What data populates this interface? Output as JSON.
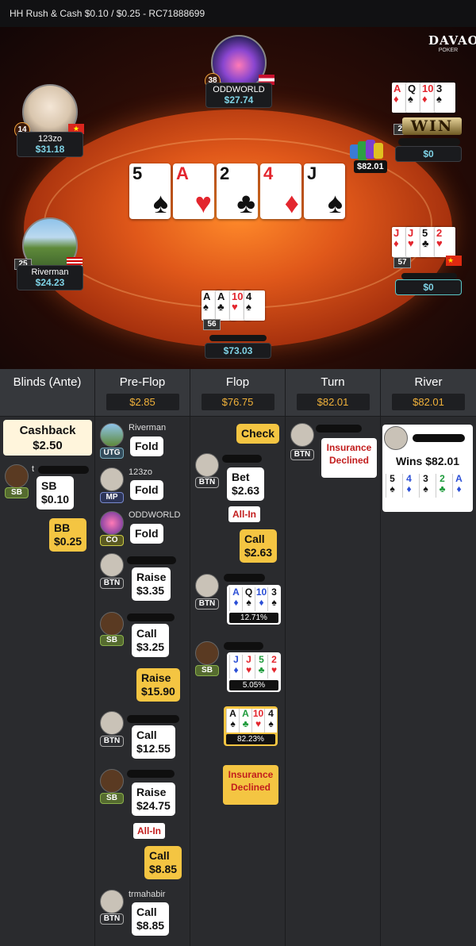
{
  "header": {
    "title": "HH  Rush & Cash $0.10 / $0.25   - RC71888699"
  },
  "logo": {
    "line1": "DAVAO",
    "line2": "POKER"
  },
  "colors": {
    "accent": "#f0b13a",
    "stack": "#7fd3e6",
    "fold_red": "#c21d1d",
    "bubble_yellow": "#f4c542"
  },
  "board": [
    {
      "rank": "5",
      "suit": "♠",
      "color": "blk"
    },
    {
      "rank": "A",
      "suit": "♥",
      "color": "red"
    },
    {
      "rank": "2",
      "suit": "♣",
      "color": "blk"
    },
    {
      "rank": "4",
      "suit": "♦",
      "color": "red"
    },
    {
      "rank": "J",
      "suit": "♠",
      "color": "blk"
    }
  ],
  "seats": {
    "top": {
      "name": "ODDWORLD",
      "stack": "$27.74",
      "level": "38"
    },
    "left_top": {
      "name": "123zo",
      "stack": "$31.18",
      "level": "14"
    },
    "left_bottom": {
      "name": "Riverman",
      "stack": "$24.23",
      "level": "25"
    },
    "bottom": {
      "stack": "$73.03",
      "level": "56"
    },
    "right_top": {
      "stack": "$0",
      "level": "25",
      "win_label": "WIN",
      "pot": "$82.01"
    },
    "right_bottom": {
      "stack": "$0",
      "level": "57"
    }
  },
  "seat_cards": {
    "bottom": [
      {
        "r": "A",
        "s": "♠",
        "c": "blk"
      },
      {
        "r": "A",
        "s": "♣",
        "c": "blk"
      },
      {
        "r": "10",
        "s": "♥",
        "c": "red"
      },
      {
        "r": "4",
        "s": "♠",
        "c": "blk"
      }
    ],
    "right_top": [
      {
        "r": "A",
        "s": "♦",
        "c": "red"
      },
      {
        "r": "Q",
        "s": "♠",
        "c": "blk"
      },
      {
        "r": "10",
        "s": "♦",
        "c": "red"
      },
      {
        "r": "3",
        "s": "♠",
        "c": "blk"
      }
    ],
    "right_bottom": [
      {
        "r": "J",
        "s": "♦",
        "c": "red"
      },
      {
        "r": "J",
        "s": "♥",
        "c": "red"
      },
      {
        "r": "5",
        "s": "♣",
        "c": "blk"
      },
      {
        "r": "2",
        "s": "♥",
        "c": "red"
      }
    ]
  },
  "history": {
    "columns": [
      {
        "title": "Blinds (Ante)",
        "pot": ""
      },
      {
        "title": "Pre-Flop",
        "pot": "$2.85"
      },
      {
        "title": "Flop",
        "pot": "$76.75"
      },
      {
        "title": "Turn",
        "pot": "$82.01"
      },
      {
        "title": "River",
        "pot": "$82.01"
      }
    ],
    "blinds": {
      "cashback_label": "Cashback",
      "cashback_value": "$2.50",
      "sb_name": "t",
      "sb_pos": "SB",
      "sb_action": "SB",
      "sb_amount": "$0.10",
      "bb_action": "BB",
      "bb_amount": "$0.25"
    },
    "preflop": [
      {
        "name": "Riverman",
        "pos": "UTG",
        "action": "Fold"
      },
      {
        "name": "123zo",
        "pos": "MP",
        "action": "Fold"
      },
      {
        "name": "ODDWORLD",
        "pos": "CO",
        "action": "Fold"
      },
      {
        "pos": "BTN",
        "action": "Raise",
        "amount": "$3.35"
      },
      {
        "pos": "SB",
        "action": "Call",
        "amount": "$3.25"
      },
      {
        "action": "Raise",
        "amount": "$15.90"
      },
      {
        "pos": "BTN",
        "action": "Call",
        "amount": "$12.55"
      },
      {
        "pos": "SB",
        "action": "Raise",
        "amount": "$24.75",
        "allin": "All-In"
      },
      {
        "action": "Call",
        "amount": "$8.85"
      },
      {
        "name": "trmahabir",
        "pos": "BTN",
        "action": "Call",
        "amount": "$8.85"
      }
    ],
    "flop": {
      "check": "Check",
      "bet_pos": "BTN",
      "bet_action": "Bet",
      "bet_amount": "$2.63",
      "bet_allin": "All-In",
      "call_action": "Call",
      "call_amount": "$2.63",
      "hand1_pos": "BTN",
      "hand1_equity": "12.71%",
      "hand2_pos": "SB",
      "hand2_equity": "5.05%",
      "hand3_equity": "82.23%",
      "insurance": "Insurance Declined"
    },
    "turn": {
      "pos": "BTN",
      "insurance": "Insurance Declined"
    },
    "river": {
      "wins": "Wins $82.01"
    }
  },
  "hands": {
    "h1": [
      {
        "r": "A",
        "s": "♦",
        "c": "blu"
      },
      {
        "r": "Q",
        "s": "♠",
        "c": "blk"
      },
      {
        "r": "10",
        "s": "♦",
        "c": "blu"
      },
      {
        "r": "3",
        "s": "♠",
        "c": "blk"
      }
    ],
    "h2": [
      {
        "r": "J",
        "s": "♦",
        "c": "blu"
      },
      {
        "r": "J",
        "s": "♥",
        "c": "red"
      },
      {
        "r": "5",
        "s": "♣",
        "c": "grn"
      },
      {
        "r": "2",
        "s": "♥",
        "c": "red"
      }
    ],
    "h3": [
      {
        "r": "A",
        "s": "♠",
        "c": "blk"
      },
      {
        "r": "A",
        "s": "♣",
        "c": "grn"
      },
      {
        "r": "10",
        "s": "♥",
        "c": "red"
      },
      {
        "r": "4",
        "s": "♠",
        "c": "blk"
      }
    ],
    "win": [
      {
        "r": "5",
        "s": "♠",
        "c": "blk"
      },
      {
        "r": "4",
        "s": "♦",
        "c": "blu"
      },
      {
        "r": "3",
        "s": "♠",
        "c": "blk"
      },
      {
        "r": "2",
        "s": "♣",
        "c": "grn"
      },
      {
        "r": "A",
        "s": "♦",
        "c": "blu"
      }
    ]
  }
}
